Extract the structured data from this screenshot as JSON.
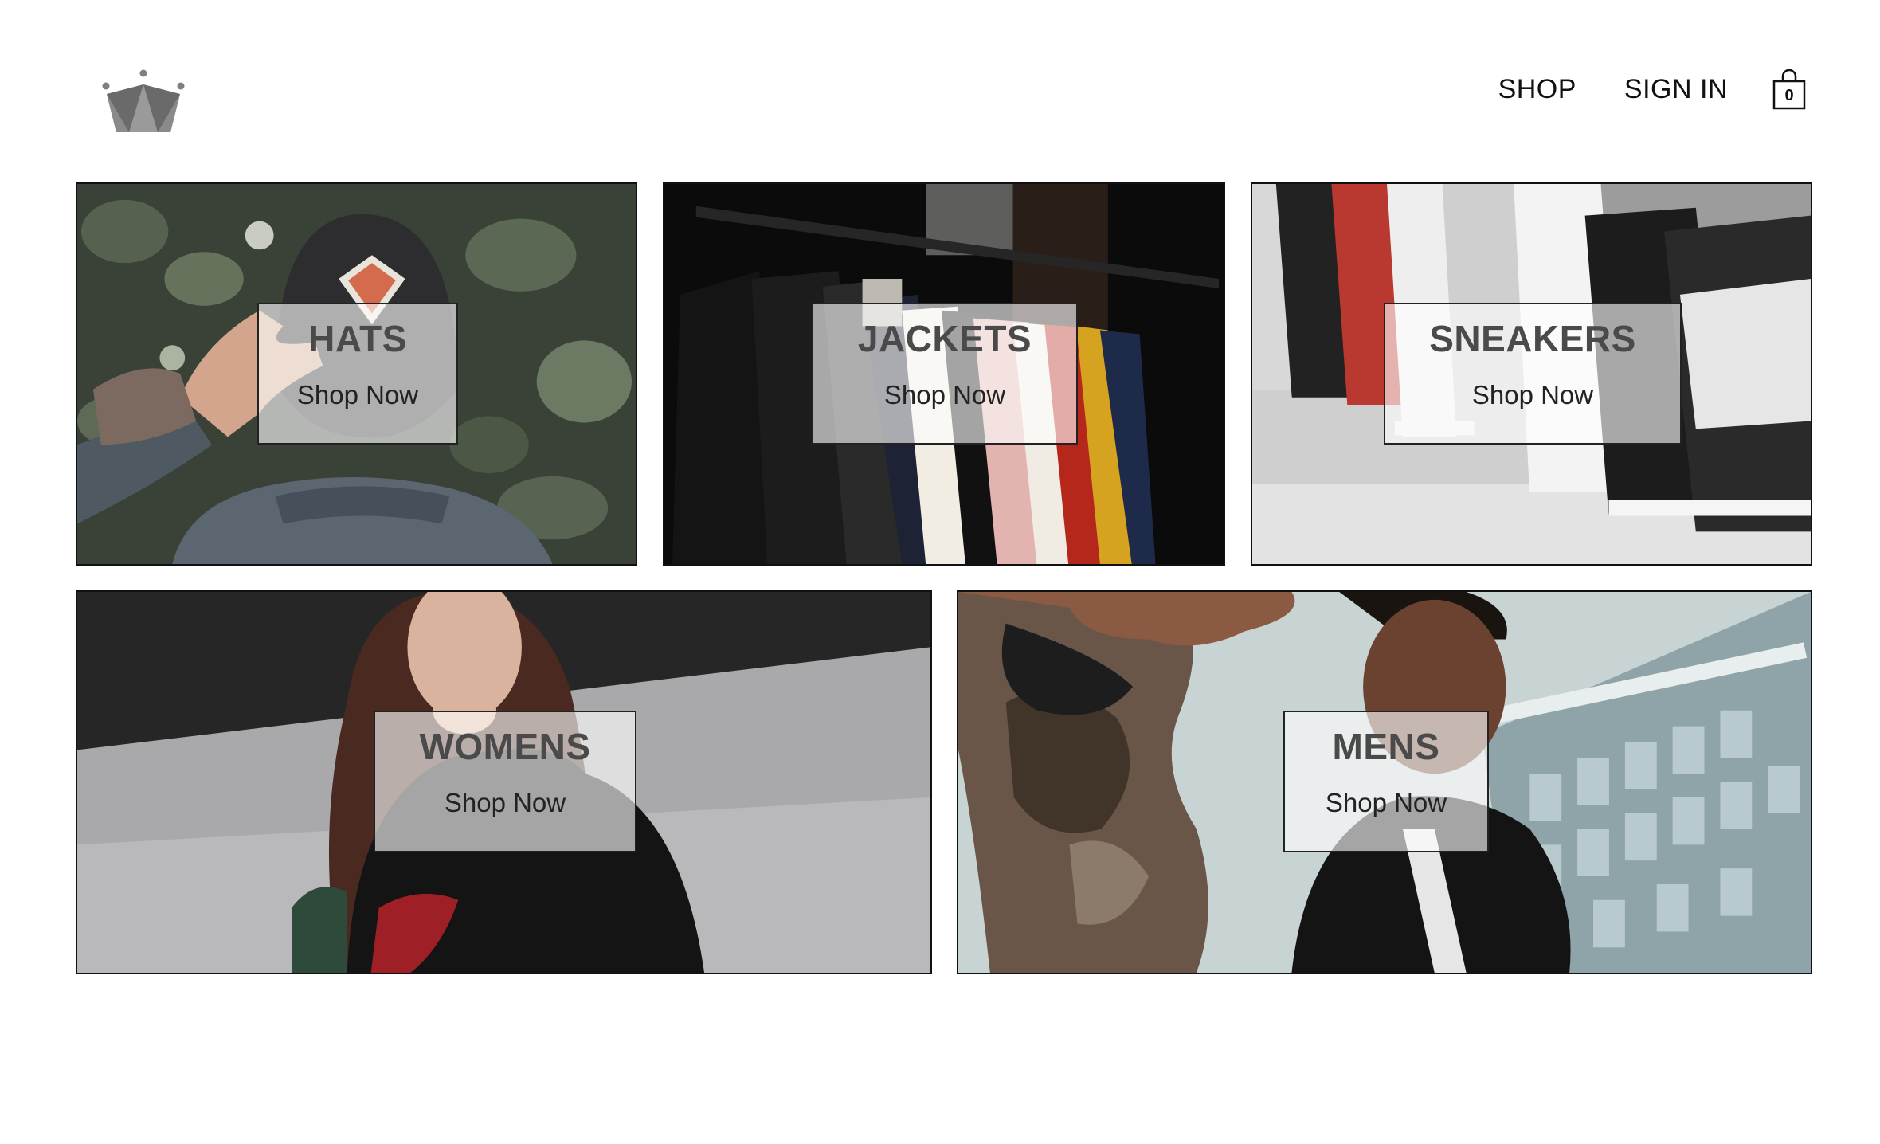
{
  "header": {
    "logo_icon": "crown-icon",
    "nav": {
      "shop_label": "SHOP",
      "signin_label": "SIGN IN"
    },
    "cart": {
      "icon": "shopping-bag-icon",
      "count": "0"
    }
  },
  "categories": [
    {
      "title": "HATS",
      "cta": "Shop Now"
    },
    {
      "title": "JACKETS",
      "cta": "Shop Now"
    },
    {
      "title": "SNEAKERS",
      "cta": "Shop Now"
    },
    {
      "title": "WOMENS",
      "cta": "Shop Now"
    },
    {
      "title": "MENS",
      "cta": "Shop Now"
    }
  ],
  "colors": {
    "text": "#111111",
    "tile_border": "#111111",
    "label_box_background": "rgba(255,255,255,0.62)",
    "logo": "#7a7a7a"
  }
}
